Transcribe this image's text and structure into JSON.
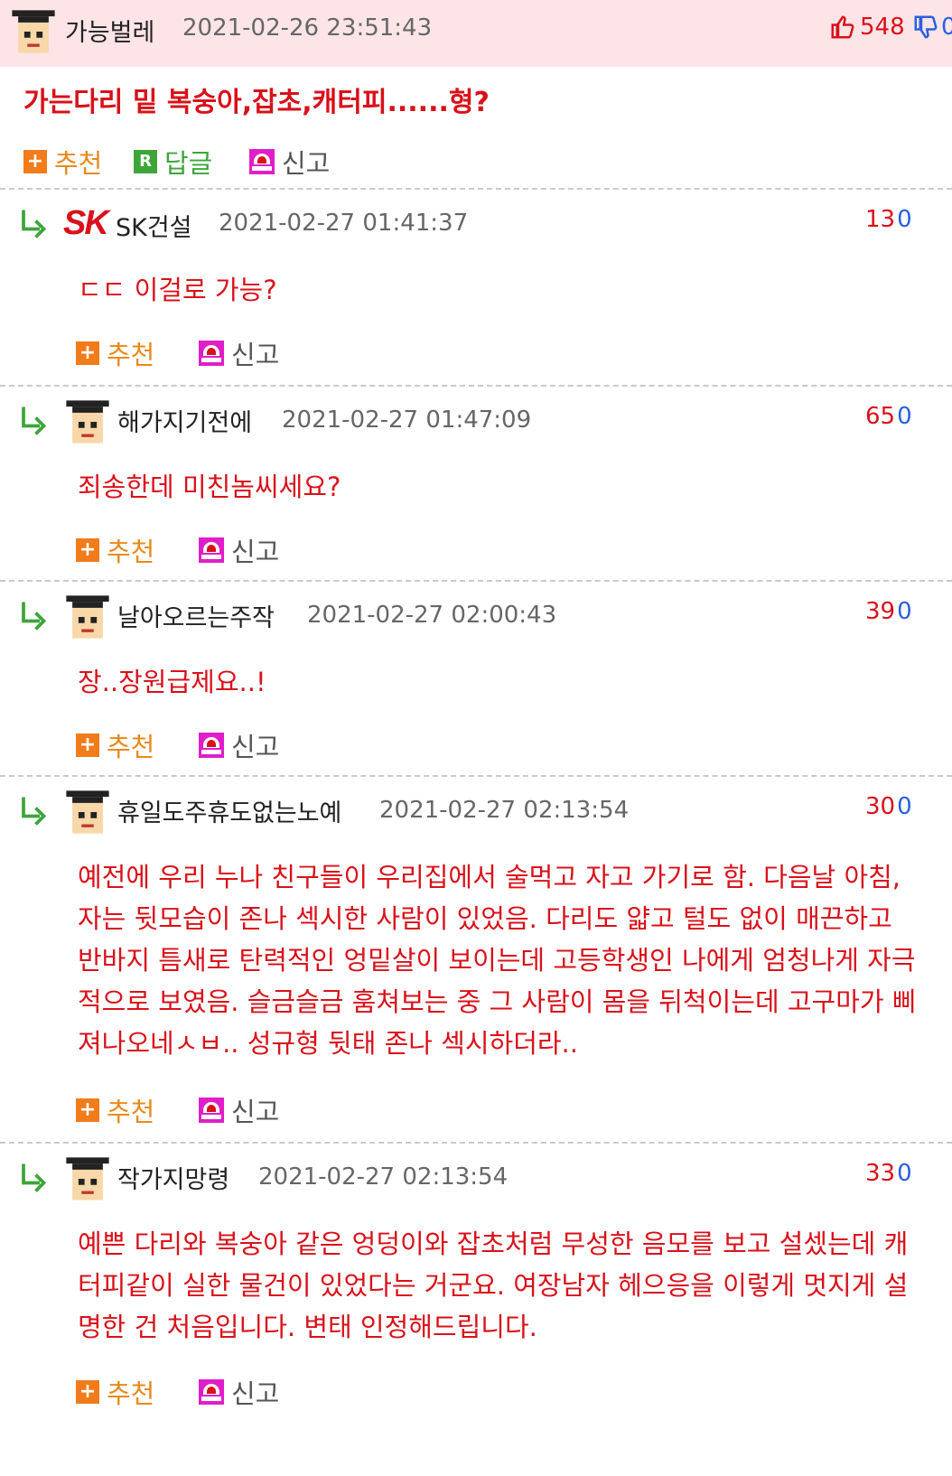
{
  "post": {
    "author": "가능벌레",
    "date": "2021-02-26 23:51:43",
    "upvotes": "548",
    "downvotes": "0",
    "title": "가는다리 밑 복숭아,잡초,캐터피......형?",
    "actions": {
      "recommend": "추천",
      "reply": "답글",
      "report": "신고"
    }
  },
  "comments": [
    {
      "author": "SK건설",
      "date": "2021-02-27 01:41:37",
      "up": "13",
      "down": "0",
      "text": "ㄷㄷ 이걸로 가능?",
      "logo": "SK",
      "recommend": "추천",
      "report": "신고"
    },
    {
      "author": "해가지기전에",
      "date": "2021-02-27 01:47:09",
      "up": "65",
      "down": "0",
      "text": "죄송한데 미친놈씨세요?",
      "recommend": "추천",
      "report": "신고"
    },
    {
      "author": "날아오르는주작",
      "date": "2021-02-27 02:00:43",
      "up": "39",
      "down": "0",
      "text": "장..장원급제요..!",
      "recommend": "추천",
      "report": "신고"
    },
    {
      "author": "휴일도주휴도없는노예",
      "date": "2021-02-27 02:13:54",
      "up": "30",
      "down": "0",
      "text": "예전에 우리 누나 친구들이 우리집에서 술먹고 자고 가기로 함. 다음날 아침, 자는 뒷모습이 존나 섹시한 사람이 있었음. 다리도 얇고 털도 없이 매끈하고 반바지 틈새로 탄력적인 엉밑살이 보이는데 고등학생인 나에게 엄청나게 자극적으로 보였음. 슬금슬금 훔쳐보는 중 그 사람이 몸을 뒤척이는데 고구마가 삐져나오네ㅅㅂ.. 성규형 뒷태 존나 섹시하더라..",
      "recommend": "추천",
      "report": "신고"
    },
    {
      "author": "작가지망령",
      "date": "2021-02-27 02:13:54",
      "up": "33",
      "down": "0",
      "text": "예쁜 다리와 복숭아 같은 엉덩이와 잡초처럼 무성한 음모를 보고 설셌는데 캐터피같이 실한 물건이 있었다는 거군요. 여장남자 헤으응을 이렇게 멋지게 설명한 건 처음입니다. 변태 인정해드립니다.",
      "recommend": "추천",
      "report": "신고"
    }
  ],
  "icons": {
    "avatar": "avatar-icon",
    "thumbs_up": "thumbs-up-icon",
    "thumbs_down": "thumbs-down-icon",
    "plus": "plus-icon",
    "reply_r": "reply-r-icon",
    "siren": "siren-icon",
    "reply_arrow": "reply-arrow-icon"
  },
  "colors": {
    "accent_red": "#d8111a",
    "header_bg": "#fde4e7",
    "recommend_orange": "#f07c1b",
    "reply_green": "#3ea53a",
    "report_magenta": "#e01ec9",
    "down_blue": "#2b5fe0"
  }
}
